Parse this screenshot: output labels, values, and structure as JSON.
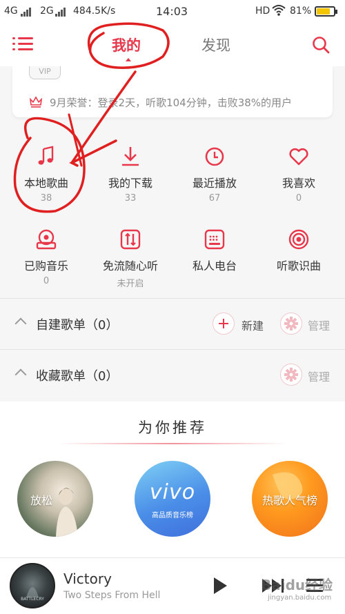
{
  "status_bar": {
    "net1": "4G",
    "net2": "2G",
    "speed": "484.5K/s",
    "time": "14:03",
    "hd": "HD",
    "battery": "81%",
    "battery_level": 0.81
  },
  "header": {
    "tab_mine": "我的",
    "tab_discover": "发现"
  },
  "card": {
    "vip": "VIP",
    "honor": "9月荣誉：登录2天，听歌104分钟，击败38%的用户"
  },
  "grid": [
    {
      "label": "本地歌曲",
      "count": "38",
      "icon": "music-note-icon"
    },
    {
      "label": "我的下载",
      "count": "33",
      "icon": "download-icon"
    },
    {
      "label": "最近播放",
      "count": "67",
      "icon": "clock-icon"
    },
    {
      "label": "我喜欢",
      "count": "0",
      "icon": "heart-icon"
    },
    {
      "label": "已购音乐",
      "count": "0",
      "icon": "purchased-music-icon"
    },
    {
      "label": "免流随心听",
      "count": "未开启",
      "icon": "data-free-icon"
    },
    {
      "label": "私人电台",
      "count": "",
      "icon": "radio-icon"
    },
    {
      "label": "听歌识曲",
      "count": "",
      "icon": "song-recognition-icon"
    }
  ],
  "sections": {
    "created": {
      "title": "自建歌单（0）",
      "new_label": "新建",
      "manage_label": "管理"
    },
    "collected": {
      "title": "收藏歌单（0）",
      "manage_label": "管理"
    }
  },
  "recommend": {
    "title": "为你推荐",
    "items": [
      {
        "label": "放松"
      },
      {
        "label": "vivo",
        "sub": "高品质音乐榜"
      },
      {
        "label": "热歌人气榜"
      }
    ]
  },
  "player": {
    "song": "Victory",
    "artist": "Two Steps From Hell",
    "album_text": "BATTLECRY"
  },
  "watermark": {
    "main": "Baidu经验",
    "sub": "jingyan.baidu.com"
  },
  "colors": {
    "accent": "#e8374a",
    "annotation": "#e02020"
  }
}
